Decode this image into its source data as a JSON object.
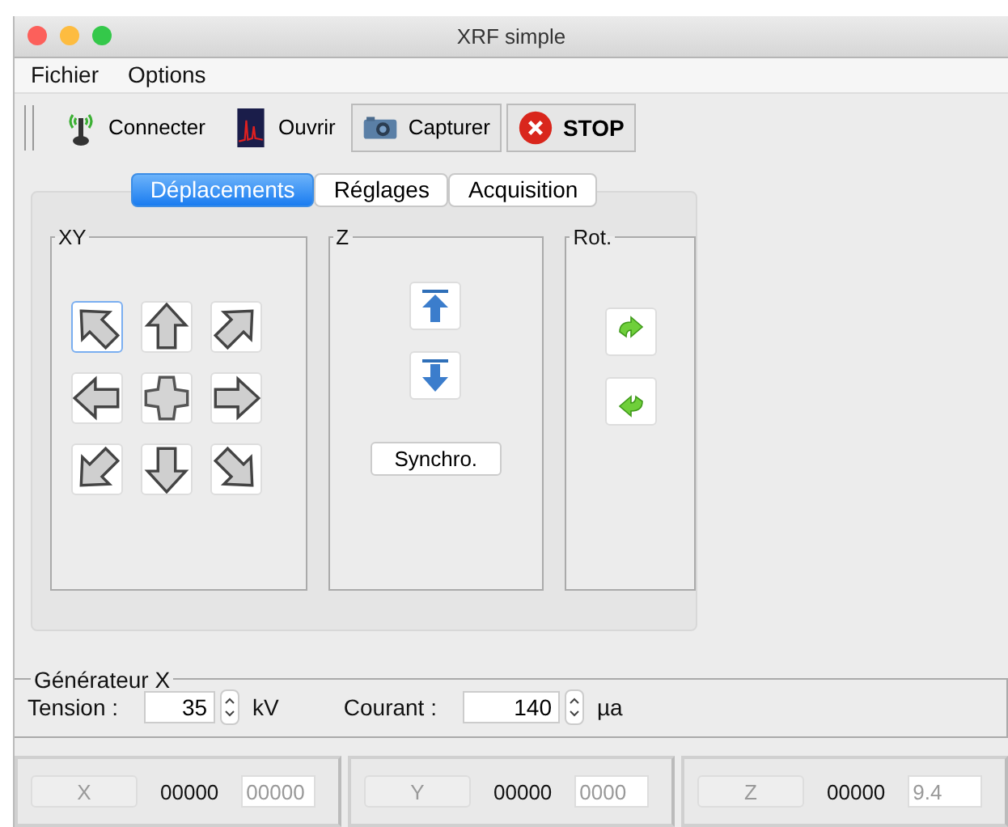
{
  "window": {
    "title": "XRF simple"
  },
  "menu": [
    "Fichier",
    "Options"
  ],
  "toolbar": [
    {
      "kind": "antenna",
      "label": "Connecter",
      "framed": false
    },
    {
      "kind": "spectrum",
      "label": "Ouvrir",
      "framed": false
    },
    {
      "kind": "camera",
      "label": "Capturer",
      "framed": true
    },
    {
      "kind": "stop",
      "label": "STOP",
      "framed": true
    }
  ],
  "tabs": [
    {
      "label": "Déplacements",
      "selected": true
    },
    {
      "label": "Réglages",
      "selected": false
    },
    {
      "label": "Acquisition",
      "selected": false
    }
  ],
  "xy": {
    "title": "XY",
    "buttons": [
      {
        "kind": "nw",
        "focused": true
      },
      {
        "kind": "n",
        "focused": false
      },
      {
        "kind": "ne",
        "focused": false
      },
      {
        "kind": "w",
        "focused": false
      },
      {
        "kind": "center",
        "focused": false
      },
      {
        "kind": "e",
        "focused": false
      },
      {
        "kind": "sw",
        "focused": false
      },
      {
        "kind": "s",
        "focused": false
      },
      {
        "kind": "se",
        "focused": false
      }
    ]
  },
  "z": {
    "title": "Z",
    "buttons": [
      {
        "kind": "top"
      },
      {
        "kind": "bottom"
      }
    ],
    "sync_label": "Synchro."
  },
  "rot": {
    "title": "Rot.",
    "buttons": [
      {
        "kind": "cw"
      },
      {
        "kind": "ccw"
      }
    ]
  },
  "generator": {
    "title": "Générateur X",
    "fields": [
      {
        "label": "Tension :",
        "value": "35",
        "unit": "kV"
      },
      {
        "label": "Courant :",
        "value": "140",
        "unit": "µa"
      }
    ]
  },
  "axes": [
    {
      "button": "X",
      "reading": "00000",
      "field": "00000"
    },
    {
      "button": "Y",
      "reading": "00000",
      "field": "0000"
    },
    {
      "button": "Z",
      "reading": "00000",
      "field": "9.4"
    }
  ]
}
